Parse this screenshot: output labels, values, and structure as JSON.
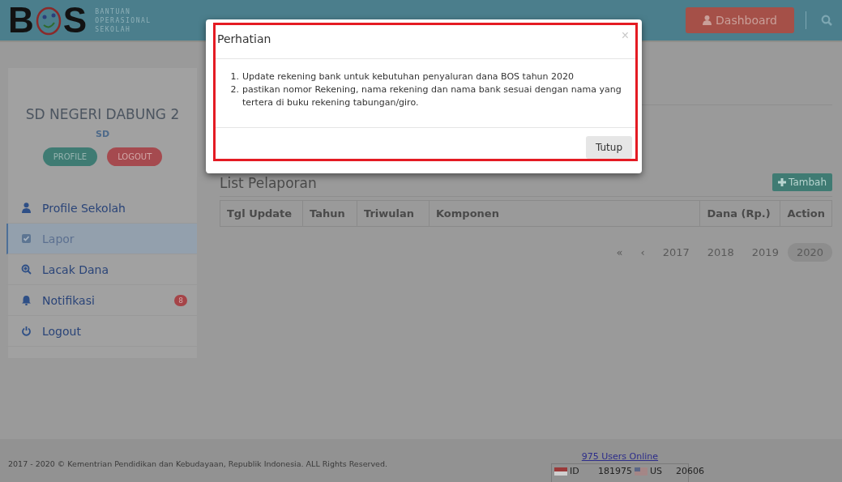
{
  "header": {
    "logo": {
      "letters": [
        "B",
        "S"
      ],
      "tagline": [
        "BANTUAN",
        "OPERASIONAL",
        "SEKOLAH"
      ]
    },
    "dashboard_button": "Dashboard"
  },
  "sidebar": {
    "school_name": "SD NEGERI DABUNG 2",
    "level": "SD",
    "buttons": [
      {
        "label": "PROFILE",
        "kind": "profile"
      },
      {
        "label": "LOGOUT",
        "kind": "logout"
      }
    ],
    "items": [
      {
        "label": "Profile Sekolah",
        "selected": false
      },
      {
        "label": "Lapor",
        "selected": true
      },
      {
        "label": "Lacak Dana",
        "selected": false
      },
      {
        "label": "Notifikasi",
        "selected": false,
        "badge": "8"
      },
      {
        "label": "Logout",
        "selected": false
      }
    ]
  },
  "content": {
    "title": "List Pelaporan",
    "add_button": "Tambah",
    "table": {
      "columns": [
        "Tgl Update",
        "Tahun",
        "Triwulan",
        "Komponen",
        "Dana (Rp.)",
        "Action"
      ]
    },
    "pagination": [
      {
        "label": "«",
        "selected": false
      },
      {
        "label": "‹",
        "selected": false
      },
      {
        "label": "2017",
        "selected": false
      },
      {
        "label": "2018",
        "selected": false
      },
      {
        "label": "2019",
        "selected": false
      },
      {
        "label": "2020",
        "selected": true
      }
    ]
  },
  "footer": {
    "copyright": "2017 - 2020 © Kementrian Pendidikan dan Kebudayaan, Republik Indonesia. ALL Rights Reserved.",
    "users_online": "975 Users Online",
    "countries": [
      {
        "code": "ID",
        "count": "181975"
      },
      {
        "code": "US",
        "count": "20606"
      }
    ]
  },
  "modal": {
    "title": "Perhatian",
    "close": "×",
    "markers": [
      "1.",
      "2."
    ],
    "items": [
      "Update rekening bank untuk kebutuhan penyaluran dana BOS tahun 2020",
      "pastikan nomor Rekening, nama rekening dan nama bank sesuai dengan nama yang tertera di buku rekening tabungan/giro."
    ],
    "button": "Tutup"
  }
}
